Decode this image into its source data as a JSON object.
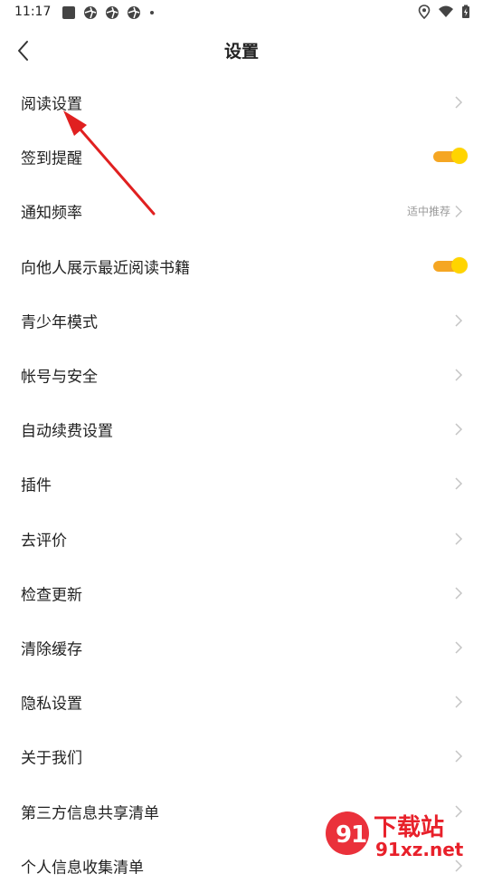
{
  "status_bar": {
    "time": "11:17"
  },
  "header": {
    "title": "设置"
  },
  "settings": [
    {
      "label": "阅读设置",
      "control": "chevron",
      "value": ""
    },
    {
      "label": "签到提醒",
      "control": "toggle",
      "value": ""
    },
    {
      "label": "通知频率",
      "control": "chevron",
      "value": "适中推荐"
    },
    {
      "label": "向他人展示最近阅读书籍",
      "control": "toggle",
      "value": ""
    },
    {
      "label": "青少年模式",
      "control": "chevron",
      "value": ""
    },
    {
      "label": "帐号与安全",
      "control": "chevron",
      "value": ""
    },
    {
      "label": "自动续费设置",
      "control": "chevron",
      "value": ""
    },
    {
      "label": "插件",
      "control": "chevron",
      "value": ""
    },
    {
      "label": "去评价",
      "control": "chevron",
      "value": ""
    },
    {
      "label": "检查更新",
      "control": "chevron",
      "value": ""
    },
    {
      "label": "清除缓存",
      "control": "chevron",
      "value": ""
    },
    {
      "label": "隐私设置",
      "control": "chevron",
      "value": ""
    },
    {
      "label": "关于我们",
      "control": "chevron",
      "value": ""
    },
    {
      "label": "第三方信息共享清单",
      "control": "chevron",
      "value": ""
    },
    {
      "label": "个人信息收集清单",
      "control": "chevron",
      "value": ""
    }
  ],
  "colors": {
    "toggle_track": "#f5a623",
    "toggle_knob": "#ffd400",
    "annotation_arrow": "#e02020",
    "watermark_red": "#e8202a"
  },
  "watermark": {
    "logo_text": "下载站",
    "site": "91xz.net"
  }
}
